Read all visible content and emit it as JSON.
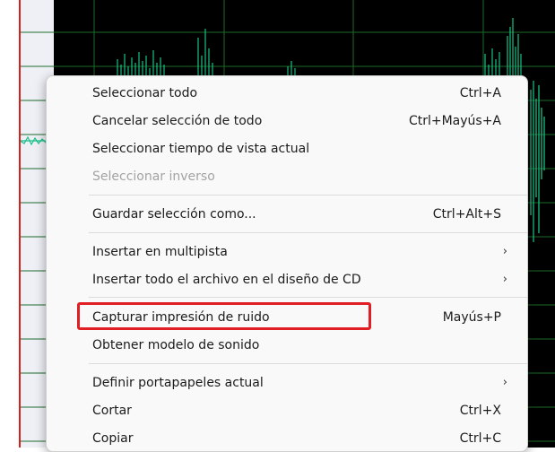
{
  "colors": {
    "waveform": "#18c088",
    "grid": "#1d6b2a",
    "playhead": "#d62020",
    "highlight": "#e01e24",
    "menu_bg": "#f9f9f9",
    "disabled_text": "#a3a3a3"
  },
  "menu": {
    "items": [
      {
        "label": "Seleccionar todo",
        "shortcut": "Ctrl+A"
      },
      {
        "label": "Cancelar selección de todo",
        "shortcut": "Ctrl+Mayús+A"
      },
      {
        "label": "Seleccionar tiempo de vista actual",
        "shortcut": ""
      },
      {
        "label": "Seleccionar inverso",
        "shortcut": "",
        "disabled": true
      },
      {
        "label": "Guardar selección como...",
        "shortcut": "Ctrl+Alt+S"
      },
      {
        "label": "Insertar en multipista",
        "shortcut": "",
        "submenu_icon": "chevron-right-icon"
      },
      {
        "label": "Insertar todo el archivo en el diseño de CD",
        "shortcut": "",
        "submenu_icon": "chevron-right-icon"
      },
      {
        "label": "Capturar impresión de ruido",
        "shortcut": "Mayús+P",
        "highlighted": true
      },
      {
        "label": "Obtener modelo de sonido",
        "shortcut": ""
      },
      {
        "label": "Definir portapapeles actual",
        "shortcut": "",
        "submenu_icon": "chevron-right-icon"
      },
      {
        "label": "Cortar",
        "shortcut": "Ctrl+X"
      },
      {
        "label": "Copiar",
        "shortcut": "Ctrl+C"
      }
    ],
    "submenu_glyph": "›"
  }
}
